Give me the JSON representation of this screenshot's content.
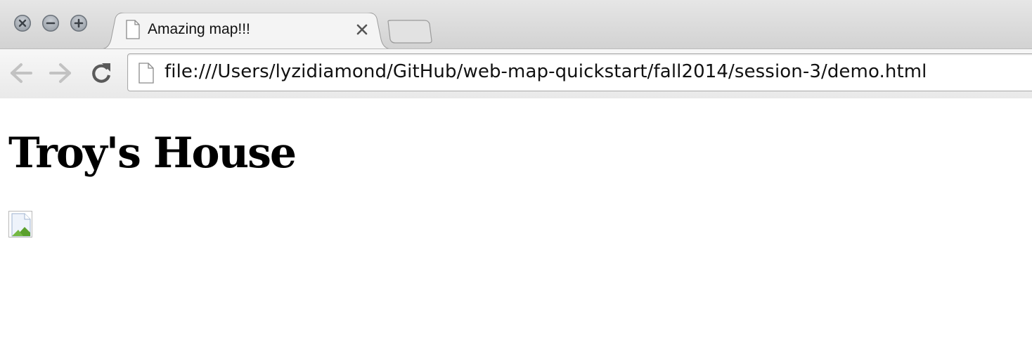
{
  "tab": {
    "title": "Amazing map!!!",
    "close_glyph": "×"
  },
  "toolbar": {
    "url": "file:///Users/lyzidiamond/GitHub/web-map-quickstart/fall2014/session-3/demo.html"
  },
  "page": {
    "heading": "Troy's House"
  },
  "icons": {
    "window_close": "close-icon",
    "window_minimize": "minimize-icon",
    "window_zoom": "zoom-icon",
    "tab_favicon": "page-icon",
    "back": "arrow-left-icon",
    "forward": "arrow-right-icon",
    "reload": "reload-icon",
    "broken_image": "broken-image-icon"
  },
  "colors": {
    "tabstrip": "#d2d2d2",
    "toolbar": "#efefef",
    "page_background": "#ffffff"
  }
}
